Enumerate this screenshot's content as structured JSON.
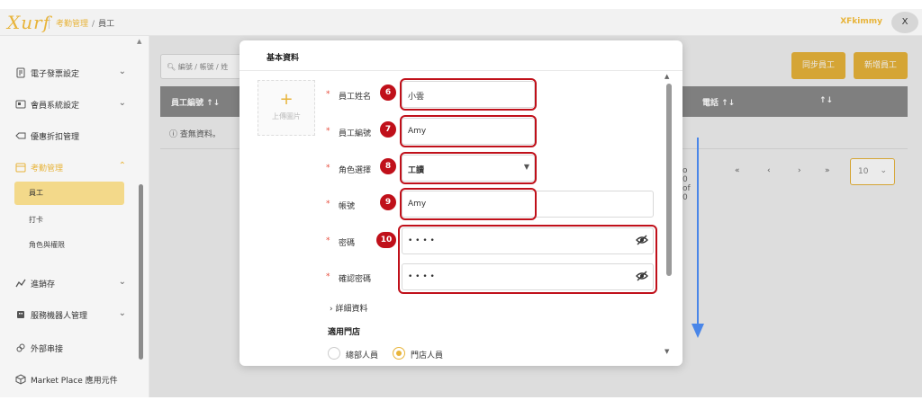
{
  "topbar": {
    "logo": "Xurf",
    "breadcrumb": [
      "考勤管理",
      "員工"
    ],
    "user_name": "XFkimmy",
    "user_button": "X"
  },
  "sidebar": {
    "items": [
      {
        "label": "電子發票設定",
        "icon": "invoice-icon",
        "expanded": false
      },
      {
        "label": "會員系統設定",
        "icon": "member-card-icon",
        "expanded": false
      },
      {
        "label": "優惠折扣管理",
        "icon": "coupon-icon"
      },
      {
        "label": "考勤管理",
        "icon": "calendar-icon",
        "expanded": true,
        "active": true
      },
      {
        "label": "進銷存",
        "icon": "inventory-icon",
        "expanded": false
      },
      {
        "label": "服務機器人管理",
        "icon": "robot-icon",
        "expanded": false
      },
      {
        "label": "外部串接",
        "icon": "link-icon"
      },
      {
        "label": "Market Place 應用元件",
        "icon": "cube-icon"
      }
    ],
    "sub_items": [
      {
        "label": "員工",
        "selected": true
      },
      {
        "label": "打卡"
      },
      {
        "label": "角色與權限"
      }
    ]
  },
  "main": {
    "search_placeholder": "編號 / 帳號 / 姓",
    "sync_button": "同步員工",
    "add_button": "新增員工",
    "table_headers": [
      "員工編號 ↑↓",
      "電話 ↑↓",
      "↑↓"
    ],
    "empty_text": "查無資料。",
    "pager": {
      "info": "o 0 of 0",
      "first": "«",
      "prev": "‹",
      "next": "›",
      "last": "»",
      "page_size": "10"
    }
  },
  "modal": {
    "title": "基本資料",
    "upload_label": "上傳圖片",
    "fields": [
      {
        "label": "員工姓名",
        "value": "小雲",
        "badge": "6"
      },
      {
        "label": "員工編號",
        "value": "Amy",
        "badge": "7"
      },
      {
        "label": "角色選擇",
        "value": "工讀",
        "badge": "8"
      },
      {
        "label": "帳號",
        "value": "Amy",
        "badge": "9"
      },
      {
        "label": "密碼",
        "value": "• • • •",
        "badge": "10"
      },
      {
        "label": "確認密碼",
        "value": "• • • •"
      }
    ],
    "details_label": "詳細資料",
    "store_title": "適用門店",
    "radio_options": [
      {
        "label": "總部人員",
        "selected": false
      },
      {
        "label": "門店人員",
        "selected": true
      }
    ]
  },
  "colors": {
    "accent": "#e8b43a",
    "highlight": "#c0101a",
    "arrow": "#4a86e8"
  }
}
